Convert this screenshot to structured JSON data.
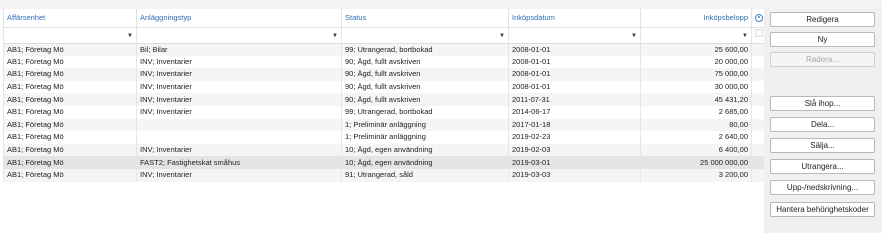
{
  "columns": {
    "c1": "Affärsenhet",
    "c2": "Anläggningstyp",
    "c3": "Status",
    "c4": "Inköpsdatum",
    "c5": "Inköpsbelopp",
    "settings_icon": "gear-icon"
  },
  "filter_icon": "chevron-down-icon",
  "rows": [
    {
      "unit": "AB1; Företag Mö",
      "type": "Bil; Bilar",
      "status": "99; Utrangerad, bortbokad",
      "date": "2008-01-01",
      "amount": "25 600,00"
    },
    {
      "unit": "AB1; Företag Mö",
      "type": "INV; Inventarier",
      "status": "90; Ägd, fullt avskriven",
      "date": "2008-01-01",
      "amount": "20 000,00"
    },
    {
      "unit": "AB1; Företag Mö",
      "type": "INV; Inventarier",
      "status": "90; Ägd, fullt avskriven",
      "date": "2008-01-01",
      "amount": "75 000,00"
    },
    {
      "unit": "AB1; Företag Mö",
      "type": "INV; Inventarier",
      "status": "90; Ägd, fullt avskriven",
      "date": "2008-01-01",
      "amount": "30 000,00"
    },
    {
      "unit": "AB1; Företag Mö",
      "type": "INV; Inventarier",
      "status": "90; Ägd, fullt avskriven",
      "date": "2011-07-31",
      "amount": "45 431,20"
    },
    {
      "unit": "AB1; Företag Mö",
      "type": "INV; Inventarier",
      "status": "99; Utrangerad, bortbokad",
      "date": "2014-06-17",
      "amount": "2 685,00"
    },
    {
      "unit": "AB1; Företag Mö",
      "type": "",
      "status": "1; Preliminär anläggning",
      "date": "2017-01-18",
      "amount": "80,00"
    },
    {
      "unit": "AB1; Företag Mö",
      "type": "",
      "status": "1; Preliminär anläggning",
      "date": "2019-02-23",
      "amount": "2 640,00"
    },
    {
      "unit": "AB1; Företag Mö",
      "type": "INV; Inventarier",
      "status": "10; Ägd, egen användning",
      "date": "2019-02-03",
      "amount": "6 400,00"
    },
    {
      "unit": "AB1; Företag Mö",
      "type": "FAST2; Fastighetskat småhus",
      "status": "10; Ägd, egen användning",
      "date": "2019-03-01",
      "amount": "25 000 000,00"
    },
    {
      "unit": "AB1; Företag Mö",
      "type": "INV; Inventarier",
      "status": "91; Utrangerad, såld",
      "date": "2019-03-03",
      "amount": "3 200,00"
    }
  ],
  "buttons": {
    "edit": "Redigera",
    "new": "Ny",
    "delete": "Radera...",
    "merge": "Slå ihop...",
    "split": "Dela...",
    "sell": "Sälja...",
    "scrap": "Utrangera...",
    "writeup": "Upp-/nedskrivning...",
    "permissions": "Hantera behörighetskoder"
  }
}
